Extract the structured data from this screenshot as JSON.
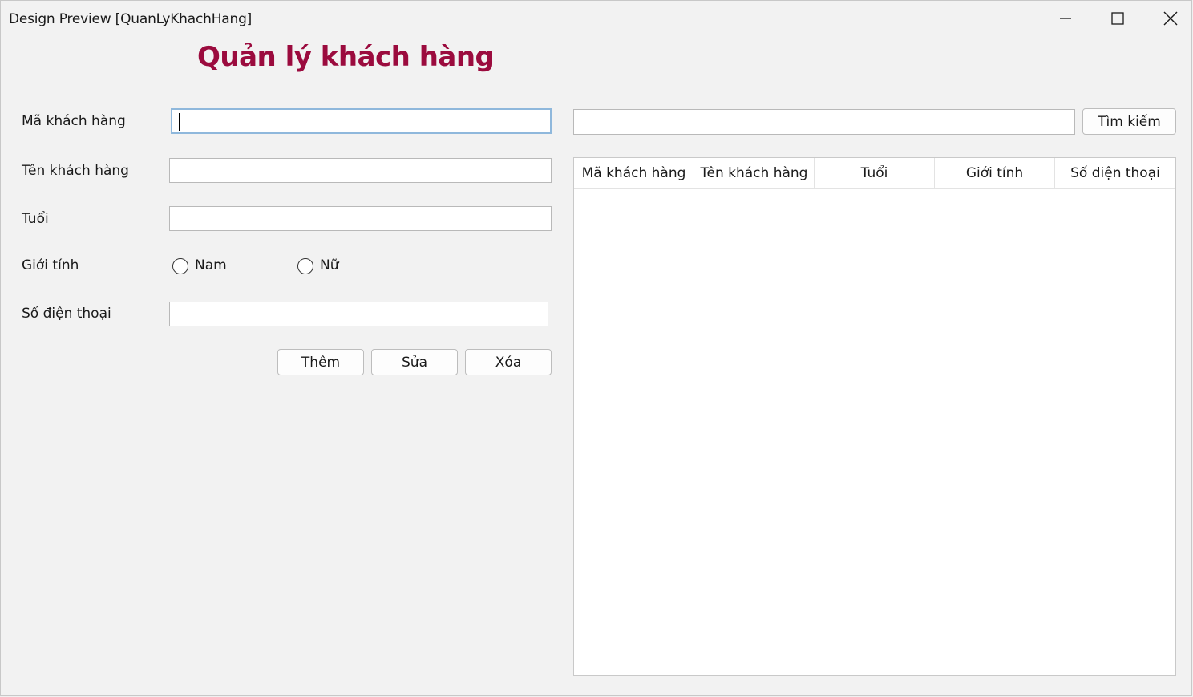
{
  "window": {
    "title": "Design Preview [QuanLyKhachHang]",
    "controls": {
      "minimize": "minimize-icon",
      "maximize": "maximize-icon",
      "close": "close-icon"
    }
  },
  "heading": "Quản lý khách hàng",
  "form": {
    "ma_label": "Mã khách hàng",
    "ma_value": "",
    "ten_label": "Tên khách hàng",
    "ten_value": "",
    "tuoi_label": "Tuổi",
    "tuoi_value": "",
    "gioitinh_label": "Giới tính",
    "gioitinh_options": [
      "Nam",
      "Nữ"
    ],
    "sdt_label": "Số điện thoại",
    "sdt_value": ""
  },
  "actions": {
    "them": "Thêm",
    "sua": "Sửa",
    "xoa": "Xóa"
  },
  "search": {
    "value": "",
    "button": "Tìm kiếm"
  },
  "table": {
    "columns": [
      "Mã khách hàng",
      "Tên khách hàng",
      "Tuổi",
      "Giới tính",
      "Số điện thoại"
    ],
    "rows": []
  },
  "colors": {
    "heading": "#9b0b3e",
    "focus_border": "#8fb8dc"
  }
}
